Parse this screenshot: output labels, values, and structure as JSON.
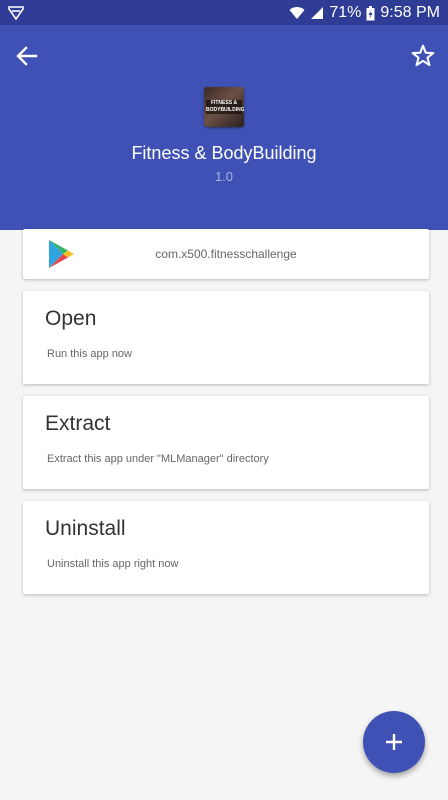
{
  "status_bar": {
    "battery": "71%",
    "time": "9:58 PM"
  },
  "header": {
    "app_name": "Fitness & BodyBuilding",
    "version": "1.0",
    "icon_text": [
      "FITNESS &",
      "BODYBUILDING"
    ]
  },
  "package": {
    "name": "com.x500.fitnesschallenge"
  },
  "actions": [
    {
      "title": "Open",
      "description": "Run this app now"
    },
    {
      "title": "Extract",
      "description": "Extract this app under \"MLManager\" directory"
    },
    {
      "title": "Uninstall",
      "description": "Uninstall this app right now"
    }
  ],
  "colors": {
    "primary": "#3f51b5",
    "status_bar": "#2f3c96",
    "background": "#f5f5f5"
  }
}
